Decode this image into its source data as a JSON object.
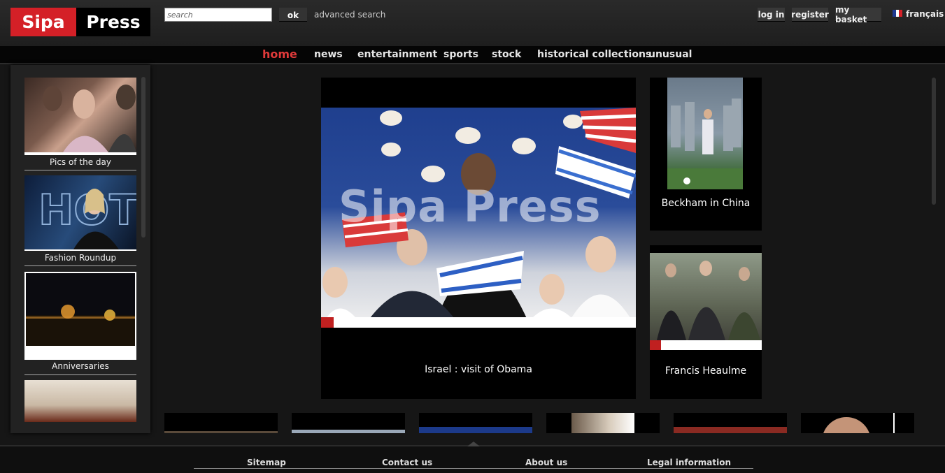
{
  "header": {
    "logo_left": "Sipa",
    "logo_right": "Press",
    "search_placeholder": "search",
    "ok_label": "ok",
    "advanced_search": "advanced search",
    "login": "log in",
    "register": "register",
    "basket": "my basket",
    "language": "français"
  },
  "nav": {
    "items": [
      "home",
      "news",
      "entertainment",
      "sports",
      "stock",
      "historical collections",
      "unusual"
    ],
    "active": "home"
  },
  "sidebar": {
    "items": [
      {
        "caption": "Pics of the day"
      },
      {
        "caption": "Fashion Roundup"
      },
      {
        "caption": "Anniversaries"
      }
    ]
  },
  "feature": {
    "caption": "Israel : visit of Obama",
    "watermark": "Sipa Press"
  },
  "cards": [
    {
      "caption": "Beckham in China"
    },
    {
      "caption": "Francis Heaulme"
    }
  ],
  "footer": {
    "links": [
      "Sitemap",
      "Contact us",
      "About us",
      "Legal information"
    ]
  },
  "colors": {
    "brand_red": "#d42027",
    "nav_active": "#e03a3a",
    "background": "#161616"
  }
}
